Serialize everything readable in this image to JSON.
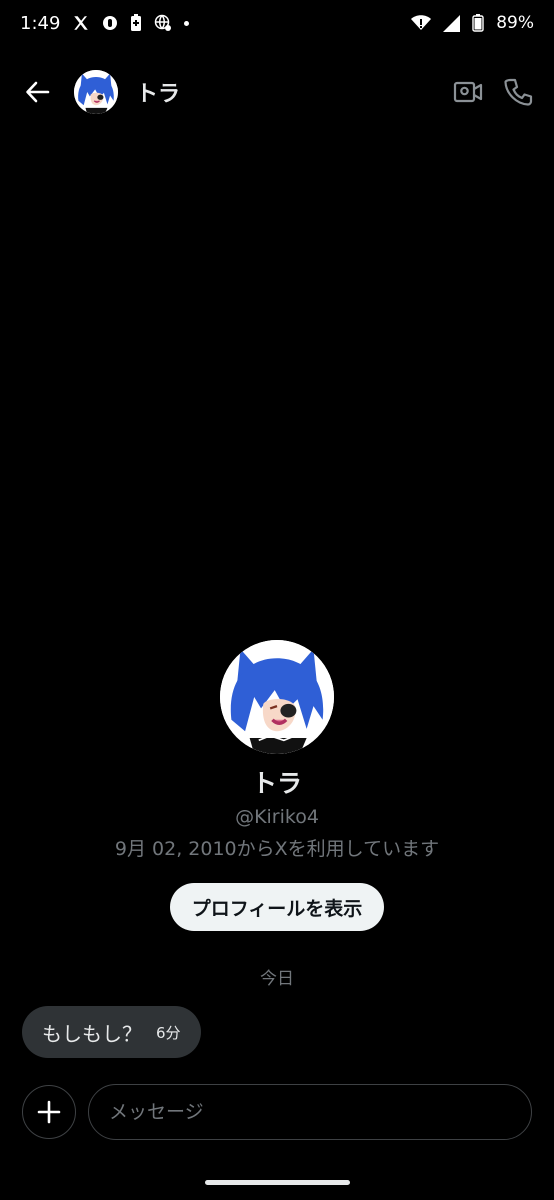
{
  "status_bar": {
    "time": "1:49",
    "battery": "89%",
    "icons": [
      "x-logo-icon",
      "vpn-icon",
      "battery-saver-icon",
      "web-icon",
      "notification-dot-icon",
      "wifi-icon",
      "signal-icon",
      "battery-icon"
    ]
  },
  "header": {
    "contact_name": "トラ",
    "back_icon": "arrow-left-icon",
    "video_icon": "video-call-icon",
    "call_icon": "phone-icon"
  },
  "profile": {
    "name": "トラ",
    "handle": "@Kiriko4",
    "joined": "9月 02, 2010からXを利用しています",
    "view_profile_label": "プロフィールを表示"
  },
  "conversation": {
    "date_divider": "今日",
    "messages": [
      {
        "text": "もしもし？",
        "time": "6分"
      }
    ]
  },
  "composer": {
    "placeholder": "メッセージ",
    "add_icon": "plus-icon"
  },
  "colors": {
    "background": "#000000",
    "bubble": "#2f3336",
    "muted_text": "#71767b",
    "primary_text": "#e7e9ea",
    "button_bg": "#eff3f4",
    "avatar_hair": "#2f5fd6"
  }
}
